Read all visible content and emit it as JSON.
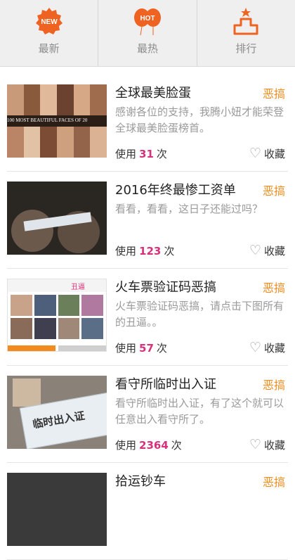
{
  "colors": {
    "accent": "#f08c1e",
    "count": "#d8317b",
    "tab_icon": "#ee6322"
  },
  "tabs": [
    {
      "label": "最新",
      "icon": "new-badge-icon",
      "badge": "NEW"
    },
    {
      "label": "最热",
      "icon": "hot-balloon-icon",
      "badge": "HOT"
    },
    {
      "label": "排行",
      "icon": "podium-icon"
    }
  ],
  "items": [
    {
      "title": "全球最美脸蛋",
      "tag": "恶搞",
      "desc": "感谢各位的支持，我腾小妞才能荣登全球最美脸蛋榜首。",
      "usage_prefix": "使用",
      "count": "31",
      "usage_suffix": "次",
      "fav": "收藏",
      "thumb_text": "100 MOST BEAUTIFUL FACES OF 20"
    },
    {
      "title": "2016年终最惨工资单",
      "tag": "恶搞",
      "desc": "看看，看看，这日子还能过吗？",
      "usage_prefix": "使用",
      "count": "123",
      "usage_suffix": "次",
      "fav": "收藏"
    },
    {
      "title": "火车票验证码恶搞",
      "tag": "恶搞",
      "desc": "火车票验证码恶搞，请点击下图所有的丑逼。。",
      "usage_prefix": "使用",
      "count": "57",
      "usage_suffix": "次",
      "fav": "收藏",
      "thumb_text": "丑逼"
    },
    {
      "title": "看守所临时出入证",
      "tag": "恶搞",
      "desc": "看守所临时出入证，有了这个就可以任意出入看守所了。",
      "usage_prefix": "使用",
      "count": "2364",
      "usage_suffix": "次",
      "fav": "收藏",
      "thumb_text": "临时出入证"
    },
    {
      "title": "拾运钞车",
      "tag": "恶搞"
    }
  ]
}
